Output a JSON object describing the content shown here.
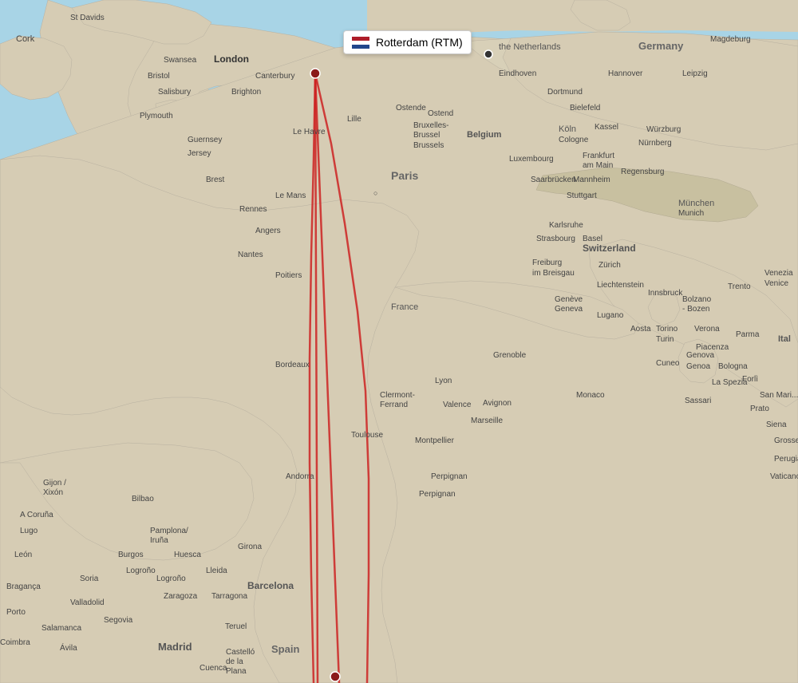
{
  "map": {
    "tooltip_city": "Rotterdam (RTM)",
    "background_sea": "#a8d4e6",
    "background_land": "#e8e0d0",
    "route_color": "#cc2222",
    "london_dot_color": "#8B1A1A"
  }
}
